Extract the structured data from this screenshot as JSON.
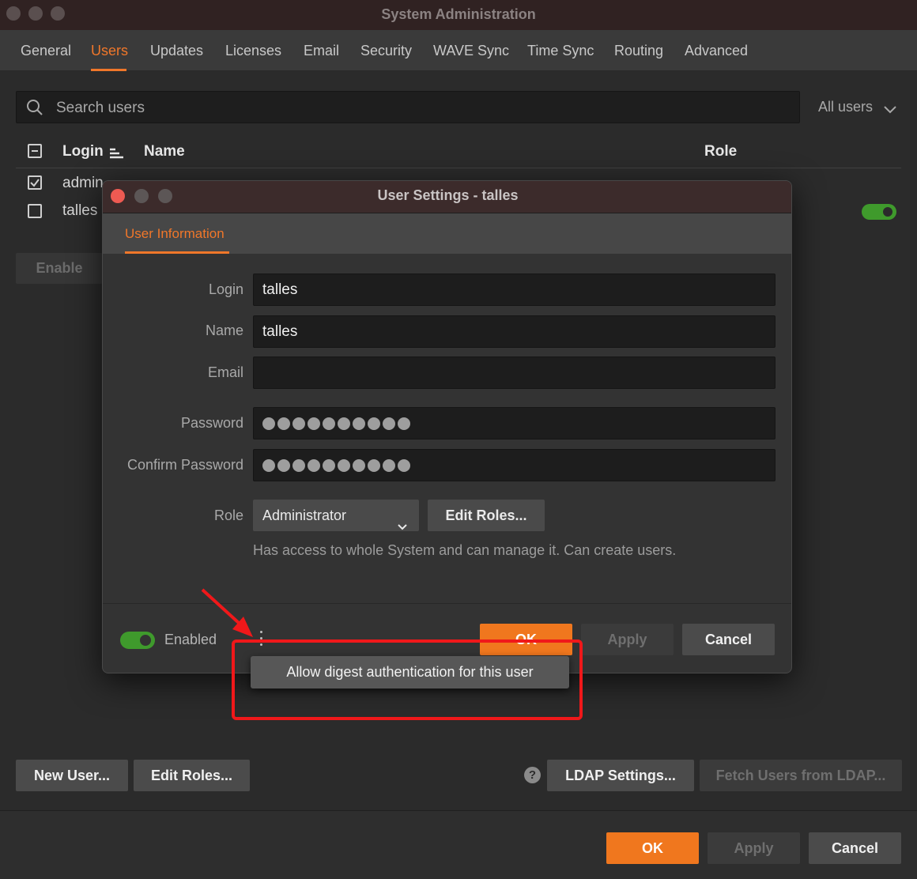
{
  "window": {
    "title": "System Administration"
  },
  "tabs": [
    "General",
    "Users",
    "Updates",
    "Licenses",
    "Email",
    "Security",
    "WAVE Sync",
    "Time Sync",
    "Routing",
    "Advanced"
  ],
  "active_tab": "Users",
  "search": {
    "placeholder": "Search users"
  },
  "filter": {
    "label": "All users"
  },
  "table": {
    "columns": {
      "login": "Login",
      "name": "Name",
      "role": "Role"
    },
    "rows": [
      {
        "login": "admin",
        "checked": true
      },
      {
        "login": "talles",
        "checked": false
      }
    ]
  },
  "buttons": {
    "enable": "Enable",
    "new_user": "New User...",
    "edit_roles": "Edit Roles...",
    "ldap_settings": "LDAP Settings...",
    "fetch_ldap": "Fetch Users from LDAP...",
    "help": "?",
    "ok": "OK",
    "apply": "Apply",
    "cancel": "Cancel"
  },
  "dialog": {
    "title": "User Settings - talles",
    "tab": "User Information",
    "fields": {
      "login_label": "Login",
      "login_value": "talles",
      "name_label": "Name",
      "name_value": "talles",
      "email_label": "Email",
      "email_value": "",
      "password_label": "Password",
      "confirm_label": "Confirm Password",
      "password_mask_length": 10
    },
    "role": {
      "label": "Role",
      "selected": "Administrator",
      "edit_roles": "Edit Roles...",
      "description": "Has access to whole System and can manage it. Can create users."
    },
    "enabled_label": "Enabled",
    "enabled": true,
    "buttons": {
      "ok": "OK",
      "apply": "Apply",
      "cancel": "Cancel"
    },
    "menu_item": "Allow digest authentication for this user"
  },
  "colors": {
    "accent": "#f0772a",
    "toggle_on": "#3f9a2c",
    "annotation": "#f0181a"
  }
}
